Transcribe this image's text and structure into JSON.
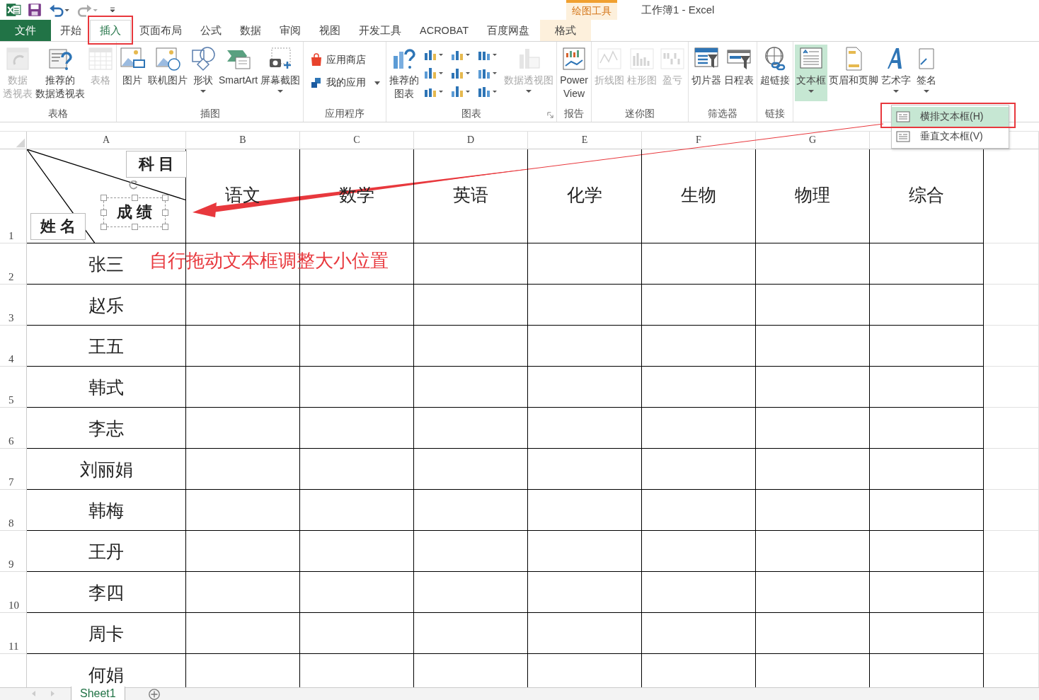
{
  "title_bar": {
    "title": "工作簿1 - Excel",
    "context_group": "绘图工具"
  },
  "tabs": [
    {
      "label": "文件",
      "kind": "file",
      "selected": false,
      "highlighted": false
    },
    {
      "label": "开始",
      "kind": "tab",
      "selected": false,
      "highlighted": false
    },
    {
      "label": "插入",
      "kind": "tab",
      "selected": true,
      "highlighted": true
    },
    {
      "label": "页面布局",
      "kind": "tab",
      "selected": false,
      "highlighted": false
    },
    {
      "label": "公式",
      "kind": "tab",
      "selected": false,
      "highlighted": false
    },
    {
      "label": "数据",
      "kind": "tab",
      "selected": false,
      "highlighted": false
    },
    {
      "label": "审阅",
      "kind": "tab",
      "selected": false,
      "highlighted": false
    },
    {
      "label": "视图",
      "kind": "tab",
      "selected": false,
      "highlighted": false
    },
    {
      "label": "开发工具",
      "kind": "tab",
      "selected": false,
      "highlighted": false
    },
    {
      "label": "ACROBAT",
      "kind": "tab",
      "selected": false,
      "highlighted": false
    },
    {
      "label": "百度网盘",
      "kind": "tab",
      "selected": false,
      "highlighted": false
    },
    {
      "label": "格式",
      "kind": "context",
      "selected": false,
      "highlighted": false
    }
  ],
  "ribbon": {
    "groups": [
      {
        "label": "表格",
        "items": [
          {
            "kind": "large",
            "lines": [
              "数据",
              "透视表"
            ],
            "disabled": true,
            "dropdown": false,
            "selected": false
          },
          {
            "kind": "large",
            "lines": [
              "推荐的",
              "数据透视表"
            ],
            "disabled": false,
            "dropdown": false,
            "selected": false
          },
          {
            "kind": "large",
            "lines": [
              "表格"
            ],
            "disabled": true,
            "dropdown": false,
            "selected": false
          }
        ]
      },
      {
        "label": "插图",
        "items": [
          {
            "kind": "large",
            "lines": [
              "图片"
            ],
            "disabled": false,
            "dropdown": false,
            "selected": false
          },
          {
            "kind": "large",
            "lines": [
              "联机图片"
            ],
            "disabled": false,
            "dropdown": false,
            "selected": false
          },
          {
            "kind": "large",
            "lines": [
              "形状"
            ],
            "disabled": false,
            "dropdown": true,
            "selected": false
          },
          {
            "kind": "large",
            "lines": [
              "SmartArt"
            ],
            "disabled": false,
            "dropdown": false,
            "selected": false
          },
          {
            "kind": "large",
            "lines": [
              "屏幕截图"
            ],
            "disabled": false,
            "dropdown": true,
            "selected": false
          }
        ]
      },
      {
        "label": "应用程序",
        "items": [
          {
            "kind": "small",
            "lines": [
              "应用商店"
            ]
          },
          {
            "kind": "small",
            "lines": [
              "我的应用"
            ]
          }
        ]
      },
      {
        "label": "图表",
        "launcher": true,
        "items": [
          {
            "kind": "large",
            "lines": [
              "推荐的",
              "图表"
            ],
            "disabled": false,
            "dropdown": false,
            "selected": false
          },
          {
            "kind": "chart-grid"
          },
          {
            "kind": "large",
            "lines": [
              "数据透视图"
            ],
            "disabled": true,
            "dropdown": true,
            "selected": false
          }
        ]
      },
      {
        "label": "报告",
        "items": [
          {
            "kind": "large",
            "lines": [
              "Power",
              "View"
            ],
            "disabled": false,
            "dropdown": false,
            "selected": false
          }
        ]
      },
      {
        "label": "迷你图",
        "items": [
          {
            "kind": "large",
            "lines": [
              "折线图"
            ],
            "disabled": true,
            "dropdown": false,
            "selected": false
          },
          {
            "kind": "large",
            "lines": [
              "柱形图"
            ],
            "disabled": true,
            "dropdown": false,
            "selected": false
          },
          {
            "kind": "large",
            "lines": [
              "盈亏"
            ],
            "disabled": true,
            "dropdown": false,
            "selected": false
          }
        ]
      },
      {
        "label": "筛选器",
        "items": [
          {
            "kind": "large",
            "lines": [
              "切片器"
            ],
            "disabled": false,
            "dropdown": false,
            "selected": false
          },
          {
            "kind": "large",
            "lines": [
              "日程表"
            ],
            "disabled": false,
            "dropdown": false,
            "selected": false
          }
        ]
      },
      {
        "label": "链接",
        "items": [
          {
            "kind": "large",
            "lines": [
              "超链接"
            ],
            "disabled": false,
            "dropdown": false,
            "selected": false
          }
        ]
      },
      {
        "items": [
          {
            "kind": "large",
            "lines": [
              "文本框"
            ],
            "disabled": false,
            "dropdown": true,
            "selected": true
          },
          {
            "kind": "large",
            "lines": [
              "页眉和页脚"
            ],
            "disabled": false,
            "dropdown": false,
            "selected": false
          },
          {
            "kind": "large",
            "lines": [
              "艺术字"
            ],
            "disabled": false,
            "dropdown": true,
            "selected": false
          },
          {
            "kind": "large",
            "lines": [
              "签名"
            ],
            "disabled": false,
            "dropdown": true,
            "selected": false
          }
        ]
      }
    ]
  },
  "text_box_menu": {
    "items": [
      {
        "label": "横排文本框(H)",
        "selected": true,
        "highlighted": true
      },
      {
        "label": "垂直文本框(V)",
        "selected": false,
        "highlighted": false
      }
    ]
  },
  "sheet": {
    "columns": [
      "A",
      "B",
      "C",
      "D",
      "E",
      "F",
      "G"
    ],
    "header_cell": {
      "top_right": "科 目",
      "middle": "成 绩",
      "bottom_left": "姓 名"
    },
    "subjects": [
      "语文",
      "数学",
      "英语",
      "化学",
      "生物",
      "物理",
      "综合"
    ],
    "row_numbers": [
      "1",
      "2",
      "3",
      "4",
      "5",
      "6",
      "7",
      "8",
      "9",
      "10",
      "11"
    ],
    "names": [
      "张三",
      "赵乐",
      "王五",
      "韩式",
      "李志",
      "刘丽娟",
      "韩梅",
      "王丹",
      "李四",
      "周卡",
      "何娟"
    ]
  },
  "annotation": {
    "note": "自行拖动文本框调整大小位置"
  },
  "sheet_tabs": [
    {
      "label": "Sheet1",
      "selected": true
    }
  ]
}
